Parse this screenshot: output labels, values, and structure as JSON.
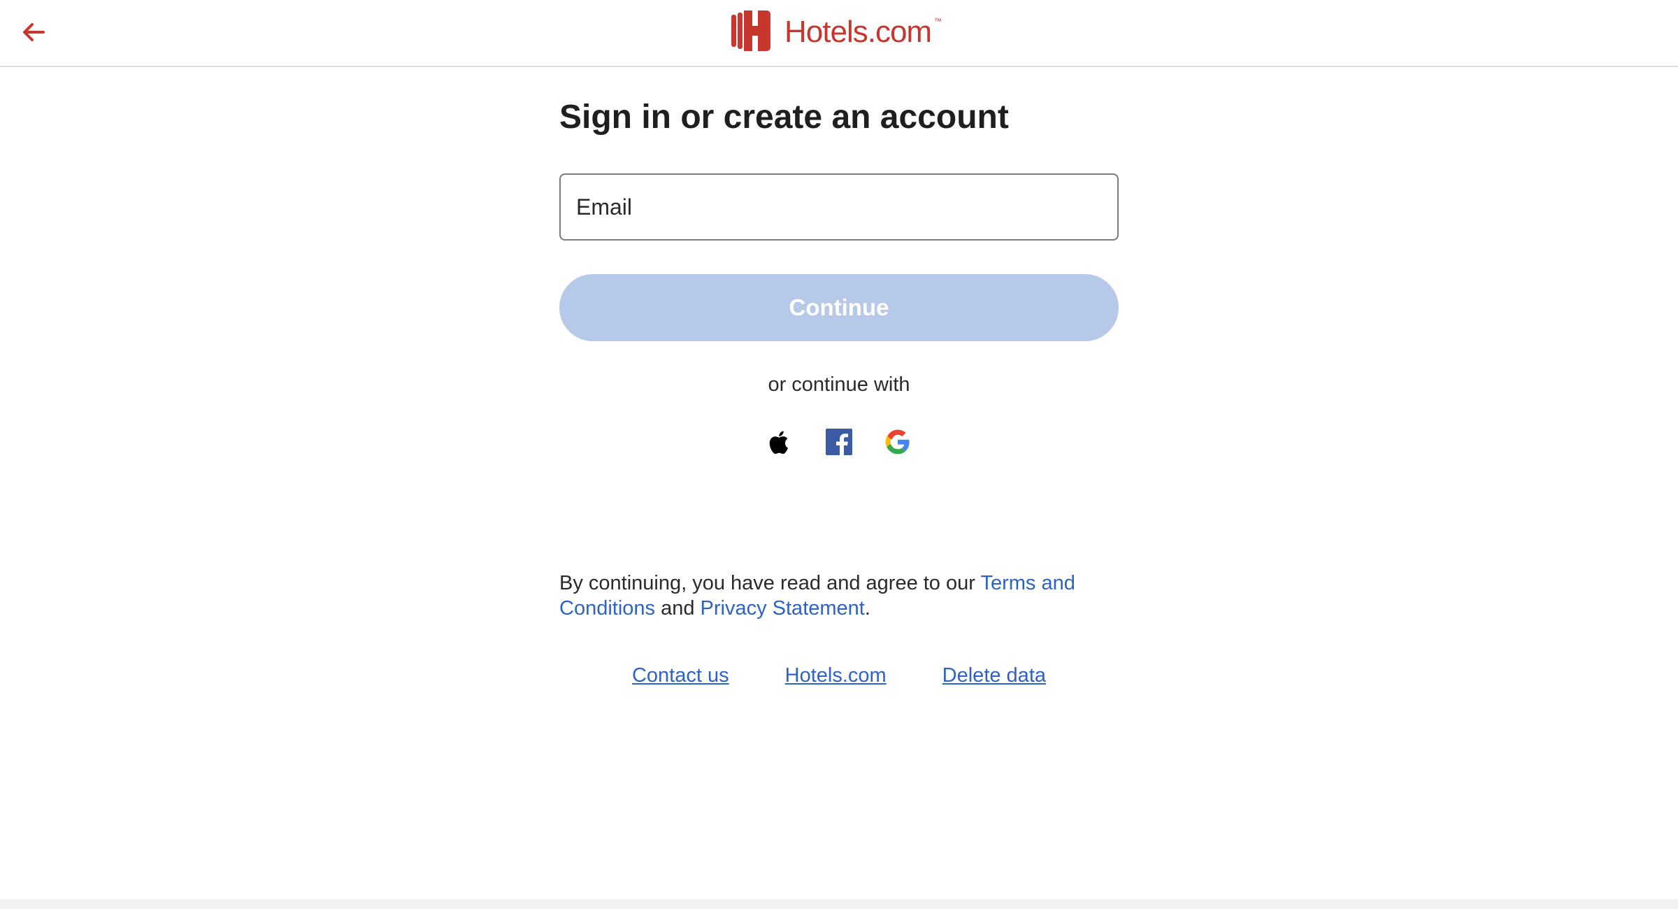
{
  "header": {
    "back_icon": "arrow-left-icon",
    "logo_text": "Hotels.com",
    "logo_tm": "™",
    "brand_color": "#c8372d"
  },
  "main": {
    "title": "Sign in or create an account",
    "email_placeholder": "Email",
    "email_value": "",
    "continue_label": "Continue",
    "continue_color": "#b6c9e8",
    "or_text": "or continue with",
    "social": [
      {
        "icon": "apple-icon"
      },
      {
        "icon": "facebook-icon"
      },
      {
        "icon": "google-icon"
      }
    ]
  },
  "legal": {
    "prefix": "By continuing, you have read and agree to our ",
    "terms_link": "Terms and Conditions",
    "middle": " and ",
    "privacy_link": "Privacy Statement",
    "suffix": "."
  },
  "footer": {
    "links": [
      "Contact us",
      "Hotels.com",
      "Delete data"
    ],
    "link_color": "#2c63c4"
  }
}
